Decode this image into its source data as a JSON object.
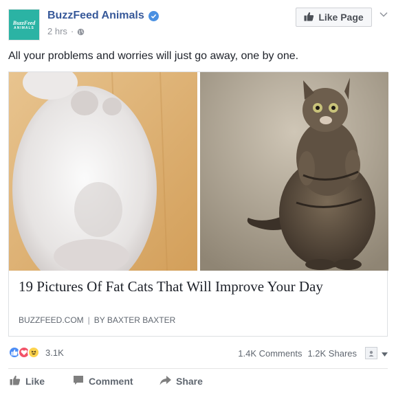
{
  "header": {
    "avatar_line1": "BuzzFeed",
    "avatar_line2": "ANIMALS",
    "page_name": "BuzzFeed Animals",
    "timestamp": "2 hrs",
    "meta_separator": "·",
    "like_page_label": "Like Page"
  },
  "post": {
    "text": "All your problems and worries will just go away, one by one."
  },
  "link": {
    "title": "19 Pictures Of Fat Cats That Will Improve Your Day",
    "domain": "BUZZFEED.COM",
    "separator": "|",
    "byline": "BY BAXTER BAXTER"
  },
  "stats": {
    "reaction_count": "3.1K",
    "comments": "1.4K Comments",
    "shares": "1.2K Shares"
  },
  "actions": {
    "like": "Like",
    "comment": "Comment",
    "share": "Share"
  },
  "colors": {
    "link_blue": "#365899",
    "verified_blue": "#4a90e2",
    "avatar_teal": "#2bb3a4",
    "like_reaction": "#4c8df6",
    "love_reaction": "#f25268",
    "haha_reaction": "#fcd34d"
  }
}
